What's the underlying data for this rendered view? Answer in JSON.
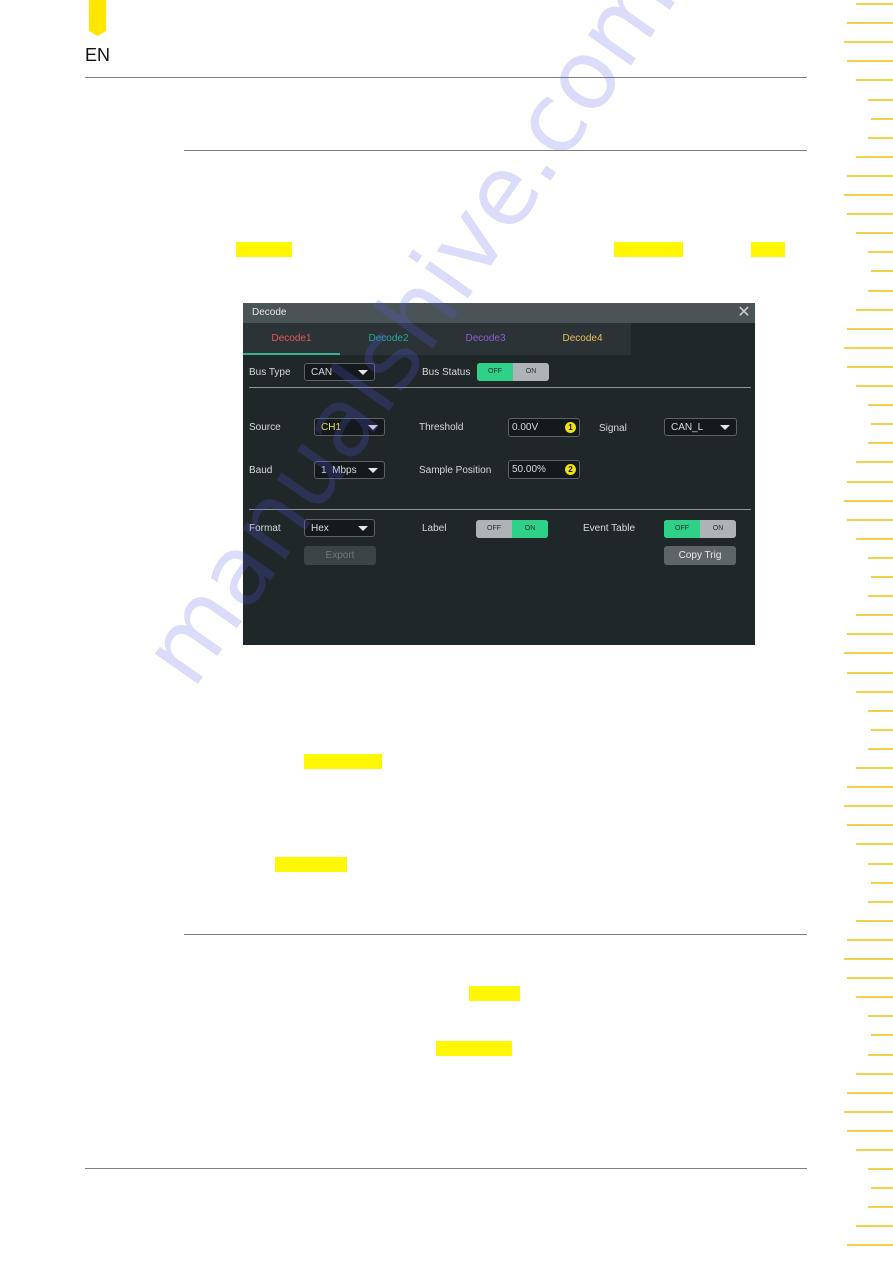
{
  "header": {
    "language": "EN"
  },
  "dialog": {
    "title": "Decode",
    "tabs": [
      {
        "label": "Decode1",
        "color": "#e05a5a",
        "active": true
      },
      {
        "label": "Decode2",
        "color": "#24a89a",
        "active": false
      },
      {
        "label": "Decode3",
        "color": "#8a5fd0",
        "active": false
      },
      {
        "label": "Decode4",
        "color": "#e8bf5a",
        "active": false
      }
    ],
    "bus_type": {
      "label": "Bus Type",
      "value": "CAN"
    },
    "bus_status": {
      "label": "Bus Status",
      "off": "OFF",
      "on": "ON",
      "state": "OFF"
    },
    "source": {
      "label": "Source",
      "value": "CH1",
      "color": "#e8e83a"
    },
    "threshold": {
      "label": "Threshold",
      "value": "0.00V",
      "knob": "1"
    },
    "signal": {
      "label": "Signal",
      "value": "CAN_L"
    },
    "baud": {
      "label": "Baud",
      "value": "1  Mbps"
    },
    "sample_position": {
      "label": "Sample Position",
      "value": "50.00%",
      "knob": "2"
    },
    "format": {
      "label": "Format",
      "value": "Hex"
    },
    "label_toggle": {
      "label": "Label",
      "off": "OFF",
      "on": "ON",
      "state": "ON"
    },
    "event_table": {
      "label": "Event Table",
      "off": "OFF",
      "on": "ON",
      "state": "OFF"
    },
    "export_button": "Export",
    "copy_trig_button": "Copy Trig"
  },
  "watermark": "manualshive.com",
  "colors": {
    "highlight": "#fff700",
    "toggle_active": "#2fd188",
    "accent_tab_underline": "#3ab390"
  }
}
